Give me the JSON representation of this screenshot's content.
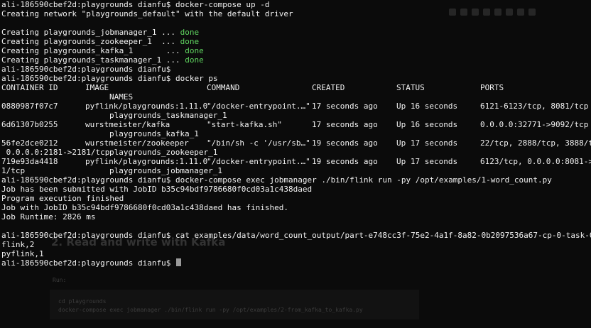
{
  "colors": {
    "background": "#0b0b0b",
    "text": "#f2f2f2",
    "done": "#5fd35f"
  },
  "ghost_page": {
    "heading": "2. Read and write with Kafka",
    "run_label": "Run:",
    "code_lines": [
      "cd playgrounds",
      "docker-compose exec jobmanager ./bin/flink run -py /opt/examples/2-from_kafka_to_kafka.py"
    ]
  },
  "terminal": {
    "compose_up": {
      "prompt": "ali-186590cbef2d:playgrounds dianfu$ docker-compose up -d",
      "network": "Creating network \"playgrounds_default\" with the default driver",
      "creating": [
        {
          "text": "Creating playgrounds_jobmanager_1 ... ",
          "status": "done"
        },
        {
          "text": "Creating playgrounds_zookeeper_1  ... ",
          "status": "done"
        },
        {
          "text": "Creating playgrounds_kafka_1       ... ",
          "status": "done"
        },
        {
          "text": "Creating playgrounds_taskmanager_1 ... ",
          "status": "done"
        }
      ],
      "empty_prompt": "ali-186590cbef2d:playgrounds dianfu$"
    },
    "docker_ps": {
      "prompt": "ali-186590cbef2d:playgrounds dianfu$ docker ps",
      "headers": {
        "container_id": "CONTAINER ID",
        "image": "IMAGE",
        "command": "COMMAND",
        "created": "CREATED",
        "status": "STATUS",
        "ports": "PORTS",
        "names": "NAMES"
      },
      "rows": [
        {
          "container_id": "0880987f07c7",
          "image": "pyflink/playgrounds:1.11.0",
          "command": "\"/docker-entrypoint.…\"",
          "created": "17 seconds ago",
          "status": "Up 16 seconds",
          "ports": "6121-6123/tcp, 8081/tcp",
          "ports_wrap": "",
          "name": "playgrounds_taskmanager_1"
        },
        {
          "container_id": "6d61307b0255",
          "image": "wurstmeister/kafka",
          "command": "\"start-kafka.sh\"",
          "created": "17 seconds ago",
          "status": "Up 16 seconds",
          "ports": "0.0.0.0:32771->9092/tcp",
          "ports_wrap": "",
          "name": "playgrounds_kafka_1"
        },
        {
          "container_id": "56fe2dce0212",
          "image": "wurstmeister/zookeeper",
          "command": "\"/bin/sh -c '/usr/sb…\"",
          "created": "19 seconds ago",
          "status": "Up 17 seconds",
          "ports": "22/tcp, 2888/tcp, 3888/tcp",
          "ports_wrap": " 0.0.0.0:2181->2181/tcp",
          "name": "playgrounds_zookeeper_1"
        },
        {
          "container_id": "719e93da4418",
          "image": "pyflink/playgrounds:1.11.0",
          "command": "\"/docker-entrypoint.…\"",
          "created": "19 seconds ago",
          "status": "Up 17 seconds",
          "ports": "6123/tcp, 0.0.0.0:8081->80",
          "ports_wrap": "1/tcp",
          "name": "playgrounds_jobmanager_1"
        }
      ]
    },
    "flink_run": {
      "prompt": "ali-186590cbef2d:playgrounds dianfu$ docker-compose exec jobmanager ./bin/flink run -py /opt/examples/1-word_count.py",
      "submitted": "Job has been submitted with JobID b35c94bdf9786680f0cd03a1c438daed",
      "finished": "Program execution finished",
      "job_finished": "Job with JobID b35c94bdf9786680f0cd03a1c438daed has finished.",
      "runtime": "Job Runtime: 2826 ms"
    },
    "cat_output": {
      "prompt": "ali-186590cbef2d:playgrounds dianfu$ cat examples/data/word_count_output/part-e748cc3f-75e2-4a1f-8a82-0b2097536a67-cp-0-task-0-file-0",
      "results": [
        "flink,2",
        "pyflink,1"
      ],
      "final_prompt": "ali-186590cbef2d:playgrounds dianfu$ "
    }
  }
}
